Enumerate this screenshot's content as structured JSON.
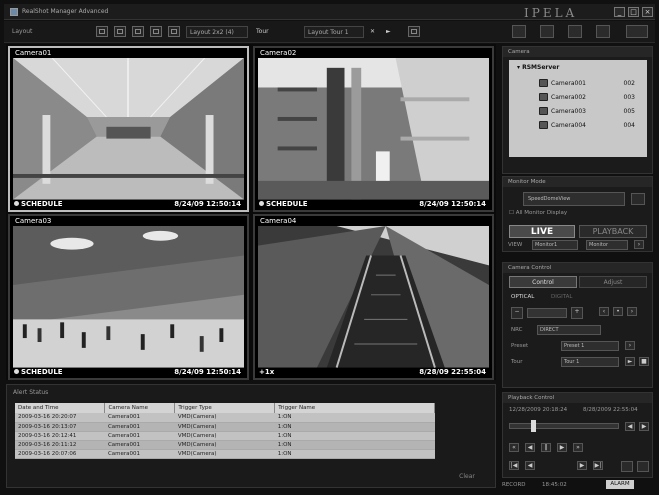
{
  "window": {
    "title": "RealShot Manager Advanced",
    "brand": "IPELA",
    "minimize_glyph": "_",
    "maximize_glyph": "□",
    "close_glyph": "×"
  },
  "toolbar": {
    "layout_label": "Layout",
    "layout_name": "Layout 2x2 (4)",
    "tour_label": "Tour",
    "tour_name": "Layout Tour 1",
    "icons": [
      "single-view-icon",
      "quad-view-icon",
      "nine-view-icon",
      "prev-icon",
      "next-icon",
      "fullscreen-icon",
      "monitor-icon",
      "keyboard-icon",
      "print-icon",
      "export-icon",
      "settings-icon"
    ]
  },
  "cameras": [
    {
      "label": "Camera01",
      "mode": "SCHEDULE",
      "timestamp": "8/24/09 12:50:14",
      "selected": true
    },
    {
      "label": "Camera02",
      "mode": "SCHEDULE",
      "timestamp": "8/24/09 12:50:14",
      "selected": false
    },
    {
      "label": "Camera03",
      "mode": "SCHEDULE",
      "timestamp": "8/24/09 12:50:14",
      "selected": false
    },
    {
      "label": "Camera04",
      "mode": "+1x",
      "timestamp": "8/28/09 22:55:04",
      "selected": false
    }
  ],
  "events": {
    "title": "Alert Status",
    "columns": [
      "Date and Time",
      "Camera Name",
      "Trigger Type",
      "Trigger Name"
    ],
    "rows": [
      [
        "2009-03-16 20:20:07",
        "Camera001",
        "VMD(Camera)",
        "1:ON"
      ],
      [
        "2009-03-16 20:13:07",
        "Camera001",
        "VMD(Camera)",
        "1:ON"
      ],
      [
        "2009-03-16 20:12:41",
        "Camera001",
        "VMD(Camera)",
        "1:ON"
      ],
      [
        "2009-03-16 20:11:12",
        "Camera001",
        "VMD(Camera)",
        "1:ON"
      ],
      [
        "2009-03-16 20:07:06",
        "Camera001",
        "VMD(Camera)",
        "1:ON"
      ]
    ],
    "clear_label": "Clear"
  },
  "device_panel": {
    "title": "Camera",
    "root": "RSMServer",
    "items": [
      {
        "name": "Camera001",
        "num": "002"
      },
      {
        "name": "Camera002",
        "num": "003"
      },
      {
        "name": "Camera003",
        "num": "005"
      },
      {
        "name": "Camera004",
        "num": "004"
      }
    ]
  },
  "monitor_panel": {
    "title": "Monitor Mode",
    "monitor_name": "SpeedDomeView",
    "checkbox_label": "All Monitor Display",
    "live_label": "LIVE",
    "playback_label": "PLAYBACK",
    "view_label": "VIEW",
    "view_value": "Monitor1",
    "layout_value": "Monitor"
  },
  "camera_control": {
    "title": "Camera Control",
    "tab_control": "Control",
    "tab_adjust": "Adjust",
    "optical_label": "OPTICAL",
    "digital_label": "DIGITAL",
    "mode_label": "NRC",
    "direct_label": "DIRECT",
    "preset_label": "Preset",
    "preset_value": "Preset 1",
    "tour_label": "Tour",
    "tour_value": "Tour 1"
  },
  "playback_panel": {
    "title": "Playback Control",
    "start_time": "12/28/2009 20:18:24",
    "end_time": "8/28/2009 22:55:04"
  },
  "status": {
    "record_label": "RECORD",
    "time": "18:45:02",
    "alarm_label": "ALARM"
  }
}
